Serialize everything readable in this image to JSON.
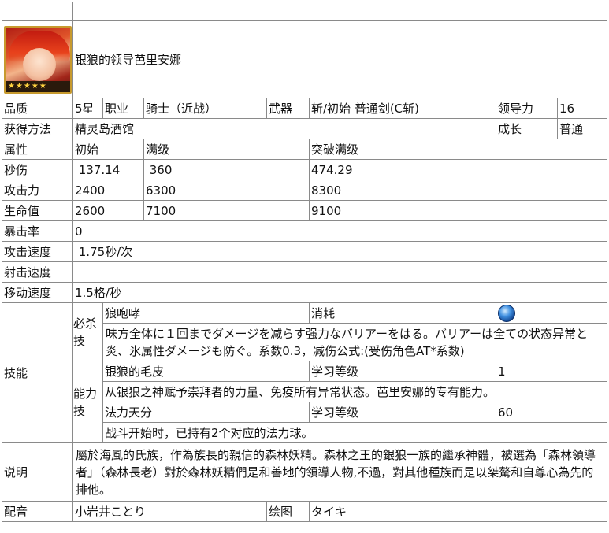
{
  "character": {
    "name": "银狼的领导芭里安娜",
    "portrait_icon": "character-portrait-icon",
    "stars": "★★★★★"
  },
  "basic": {
    "quality_label": "品质",
    "quality_value": "5星",
    "class_label": "职业",
    "class_value": "骑士（近战）",
    "weapon_label": "武器",
    "weapon_value": "斩/初始 普通剑(C斩)",
    "leadership_label": "领导力",
    "leadership_value": "16",
    "obtain_label": "获得方法",
    "obtain_value": "精灵岛酒馆",
    "growth_label": "成长",
    "growth_value": "普通"
  },
  "stats": {
    "header": [
      "属性",
      "初始",
      "满级",
      "突破满级"
    ],
    "rows": [
      {
        "label": "秒伤",
        "initial": " 137.14",
        "max": " 360",
        "break_max": "474.29"
      },
      {
        "label": "攻击力",
        "initial": "2400",
        "max": "6300",
        "break_max": "8300"
      },
      {
        "label": "生命值",
        "initial": "2600",
        "max": "7100",
        "break_max": "9100"
      }
    ],
    "crit_label": "暴击率",
    "crit_value": "0",
    "atk_speed_label": "攻击速度",
    "atk_speed_value": " 1.75秒/次",
    "shoot_speed_label": "射击速度",
    "shoot_speed_value": "",
    "move_speed_label": "移动速度",
    "move_speed_value": "1.5格/秒"
  },
  "skills": {
    "label": "技能",
    "special": {
      "label": "必杀技",
      "name": "狼咆哮",
      "cost_label": "消耗",
      "cost_icon": "blue-orb-icon",
      "description": "味方全体に１回までダメージを减らす强力なバリアーをはる。バリアーは全ての状态异常と炎、氷属性ダメージも防ぐ。系数0.3，减伤公式:(受伤角色AT*系数)"
    },
    "ability": {
      "label": "能力技",
      "first_name": "银狼的毛皮",
      "first_level_label": "学习等级",
      "first_level": "1",
      "first_description": "从银狼之神赋予崇拜者的力量、免疫所有异常状态。芭里安娜的专有能力。",
      "second_name": "法力天分",
      "second_level_label": "学习等级",
      "second_level": "60",
      "second_description": "战斗开始时，已持有2个对应的法力球。"
    }
  },
  "description": {
    "label": "说明",
    "text": "屬於海風的氏族，作為族長的親信的森林妖精。森林之王的銀狼一族的繼承神體，被選為「森林領導者」（森林長老）對於森林妖精們是和善地的領導人物,不過，對其他種族而是以桀驁和自尊心為先的排他。"
  },
  "credits": {
    "voice_label": "配音",
    "voice_value": "小岩井ことり",
    "art_label": "绘图",
    "art_value": "タイキ"
  }
}
